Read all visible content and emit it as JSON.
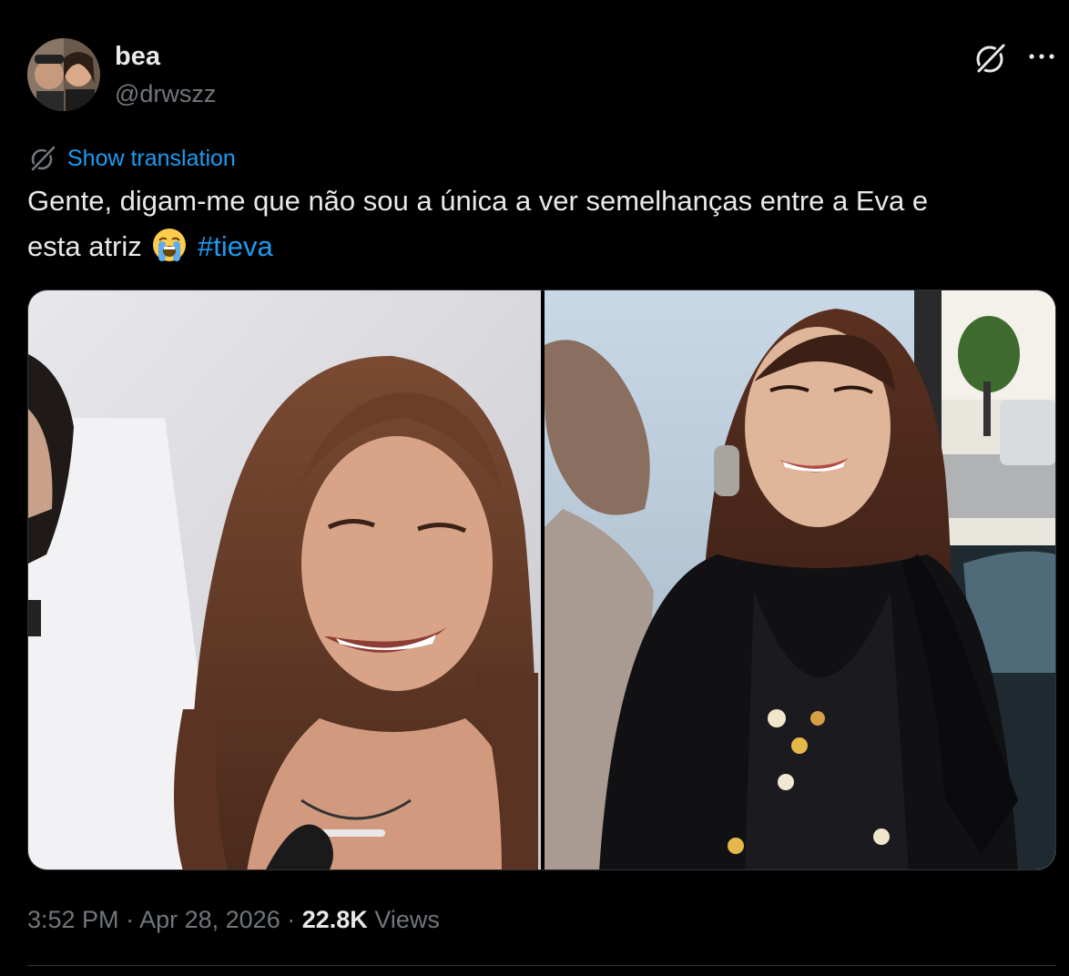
{
  "author": {
    "display_name": "bea",
    "handle": "@drwszz",
    "avatar_icon": "profile-photo"
  },
  "actions": {
    "grok_icon": "grok-icon",
    "more_icon": "more-icon",
    "more_label": "···"
  },
  "translate": {
    "icon": "translate-icon",
    "label": "Show translation"
  },
  "tweet": {
    "text_line1": "Gente, digam-me que não sou a única a ver semelhanças entre a Eva e",
    "text_line2": "esta atriz",
    "emoji": "😭",
    "hashtag": "#tieva"
  },
  "media": {
    "photos": [
      "photo-left",
      "photo-right"
    ]
  },
  "meta": {
    "time": "3:52 PM",
    "separator": "·",
    "date": "Apr 28, 2026",
    "views_count": "22.8K",
    "views_label": "Views"
  },
  "colors": {
    "background": "#000000",
    "text": "#e7e9ea",
    "secondary": "#71767b",
    "accent": "#1d9bf0",
    "border": "#2f3336"
  }
}
